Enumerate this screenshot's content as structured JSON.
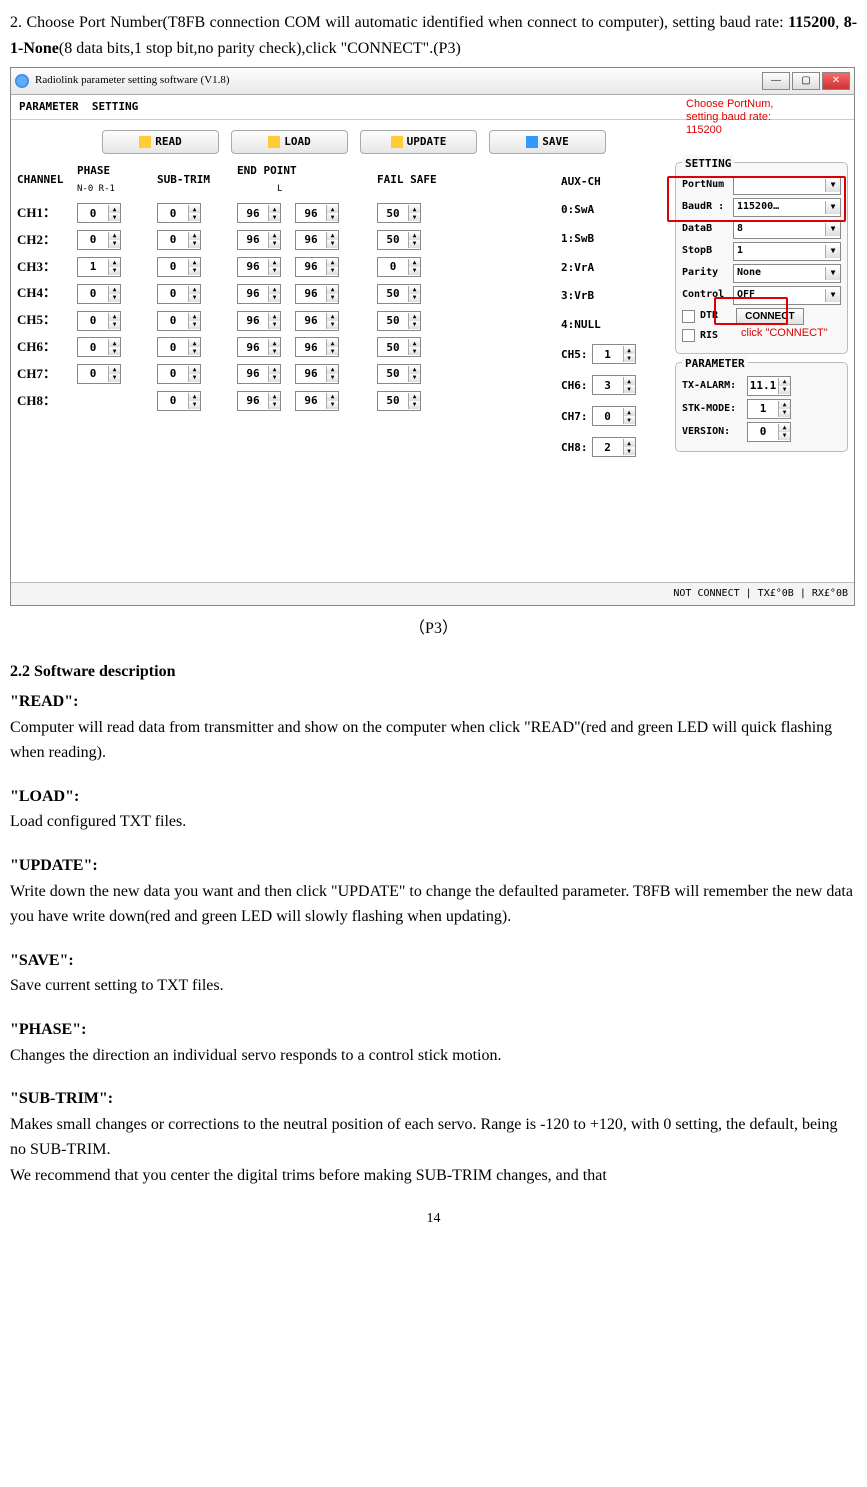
{
  "intro": {
    "text_pre": "2. Choose Port Number(T8FB connection COM will automatic identified when connect to computer), setting baud rate: ",
    "baud": "115200",
    "sep": ", ",
    "protocol": "8-1-None",
    "text_post": "(8 data bits,1 stop bit,no parity check),click \"CONNECT\".(P3)"
  },
  "window": {
    "title": "Radiolink parameter setting software (V1.8)",
    "menu1": "PARAMETER",
    "menu2": "SETTING"
  },
  "toolbar": {
    "read": "READ",
    "load": "LOAD",
    "update": "UPDATE",
    "save": "SAVE"
  },
  "headers": {
    "channel": "CHANNEL",
    "phase": "PHASE",
    "phase_sub": "N-0 R-1",
    "subtrim": "SUB-TRIM",
    "endpoint": "END POINT",
    "endpoint_sub": "L",
    "failsafe": "FAIL SAFE",
    "auxch": "AUX-CH",
    "setting": "SETTING"
  },
  "channels": [
    {
      "name": "CH1：",
      "phase": "0",
      "sub": "0",
      "epL": "96",
      "epR": "96",
      "fs": "50"
    },
    {
      "name": "CH2：",
      "phase": "0",
      "sub": "0",
      "epL": "96",
      "epR": "96",
      "fs": "50"
    },
    {
      "name": "CH3：",
      "phase": "1",
      "sub": "0",
      "epL": "96",
      "epR": "96",
      "fs": "0"
    },
    {
      "name": "CH4：",
      "phase": "0",
      "sub": "0",
      "epL": "96",
      "epR": "96",
      "fs": "50"
    },
    {
      "name": "CH5：",
      "phase": "0",
      "sub": "0",
      "epL": "96",
      "epR": "96",
      "fs": "50"
    },
    {
      "name": "CH6：",
      "phase": "0",
      "sub": "0",
      "epL": "96",
      "epR": "96",
      "fs": "50"
    },
    {
      "name": "CH7：",
      "phase": "0",
      "sub": "0",
      "epL": "96",
      "epR": "96",
      "fs": "50"
    },
    {
      "name": "CH8：",
      "phase": "",
      "sub": "0",
      "epL": "96",
      "epR": "96",
      "fs": "50"
    }
  ],
  "aux": {
    "a0": "0:SwA",
    "a1": "1:SwB",
    "a2": "2:VrA",
    "a3": "3:VrB",
    "a4": "4:NULL",
    "ch5": {
      "label": "CH5:",
      "val": "1"
    },
    "ch6": {
      "label": "CH6:",
      "val": "3"
    },
    "ch7": {
      "label": "CH7:",
      "val": "0"
    },
    "ch8": {
      "label": "CH8:",
      "val": "2"
    }
  },
  "settings": {
    "portnum": {
      "label": "PortNum",
      "val": ""
    },
    "baudr": {
      "label": "BaudR :",
      "val": "115200…"
    },
    "datab": {
      "label": "DataB",
      "val": "8"
    },
    "stopb": {
      "label": "StopB",
      "val": "1"
    },
    "parity": {
      "label": "Parity",
      "val": "None"
    },
    "control": {
      "label": "Control",
      "val": "OFF"
    },
    "dtr": "DTR",
    "ris": "RIS",
    "connect": "CONNECT"
  },
  "parameter": {
    "title": "PARAMETER",
    "txalarm": {
      "label": "TX-ALARM:",
      "val": "11.1"
    },
    "stkmode": {
      "label": "STK-MODE:",
      "val": "1"
    },
    "version": {
      "label": "VERSION:",
      "val": "0"
    }
  },
  "annotations": {
    "top1": "Choose PortNum,",
    "top2": "setting baud rate:",
    "top3": "115200",
    "bottom": "click \"CONNECT\""
  },
  "statusbar": "NOT CONNECT | TX£°0B | RX£°0B",
  "caption": "（P3）",
  "section22": "2.2 Software description",
  "descriptions": {
    "read": {
      "term": "\"READ\":",
      "body": "Computer will read data from transmitter and show on the computer when click \"READ\"(red and green LED will quick flashing when reading)."
    },
    "load": {
      "term": "\"LOAD\":",
      "body": "Load configured TXT files."
    },
    "update": {
      "term": "\"UPDATE\":",
      "body": "Write down the new data you want and then click \"UPDATE\" to change the defaulted parameter. T8FB will remember the new data you have write down(red and green LED will slowly flashing when updating)."
    },
    "save": {
      "term": "\"SAVE\":",
      "body": "Save current setting to TXT files."
    },
    "phase": {
      "term": "\"PHASE\":",
      "body": "Changes the direction an individual servo responds to a control stick motion."
    },
    "subtrim": {
      "term": "\"SUB-TRIM\":",
      "body1": "Makes small changes or corrections to the neutral position of each servo. Range is -120 to +120, with 0 setting, the default, being no SUB-TRIM.",
      "body2": "We recommend that you center the digital trims before making SUB-TRIM changes, and that"
    }
  },
  "page_num": "14"
}
